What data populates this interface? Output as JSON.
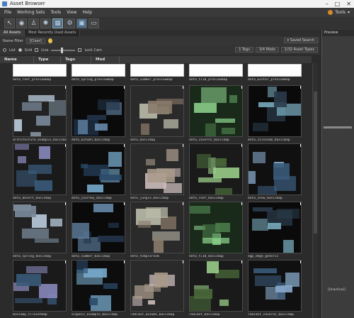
{
  "window": {
    "title": "Asset Browser"
  },
  "menu": {
    "items": [
      "File",
      "Working Sets",
      "Tools",
      "View",
      "Help"
    ],
    "tools_label": "Tools"
  },
  "tabs": [
    "All Assets",
    "Most Recently Used Assets"
  ],
  "filter": {
    "label": "Name Filter",
    "clear_label": "Clear",
    "saved_search_label": "Saved Search"
  },
  "options": {
    "list_label": "List",
    "grid_label": "Grid",
    "live_label": "Live",
    "lock_cam_label": "Lock Cam",
    "tags_btn": "1 Tags",
    "mods_btn": "3/4 Mods",
    "asset_types_btn": "1/32 Asset Types"
  },
  "columns": [
    "Name",
    "Type",
    "Tags",
    "Mod"
  ],
  "preview": {
    "title": "Preview",
    "status": "[Inactive]"
  },
  "assets": [
    {
      "name": "dota_reef_previewmap"
    },
    {
      "name": "dota_spring_previewmap"
    },
    {
      "name": "dota_summer_previewmap"
    },
    {
      "name": "dota_ti10_previewmap"
    },
    {
      "name": "dota_winter_previewmap"
    },
    {
      "name": "architecture_example_basicmap"
    },
    {
      "name": "dota_autumn_basicmap"
    },
    {
      "name": "dota_basicmap"
    },
    {
      "name": "dota_caverns_basicmap"
    },
    {
      "name": "dota_coloseum_basicmap"
    },
    {
      "name": "dota_desert_basicmap"
    },
    {
      "name": "dota_journey_basicmap"
    },
    {
      "name": "dota_jungle_basicmap"
    },
    {
      "name": "dota_reef_basicmap"
    },
    {
      "name": "dota_snow_basicmap"
    },
    {
      "name": "dota_spring_basicmap"
    },
    {
      "name": "dota_summer_basicmap"
    },
    {
      "name": "dota_templeroom"
    },
    {
      "name": "dota_ti10_basicmap"
    },
    {
      "name": "egp_edge_generic"
    },
    {
      "name": "minimap_tilesetmap"
    },
    {
      "name": "organic_example_basicmap"
    },
    {
      "name": "radiant_autumn_basicmap"
    },
    {
      "name": "radiant_basicmap"
    },
    {
      "name": "radiant_caverns_basicmap"
    }
  ]
}
